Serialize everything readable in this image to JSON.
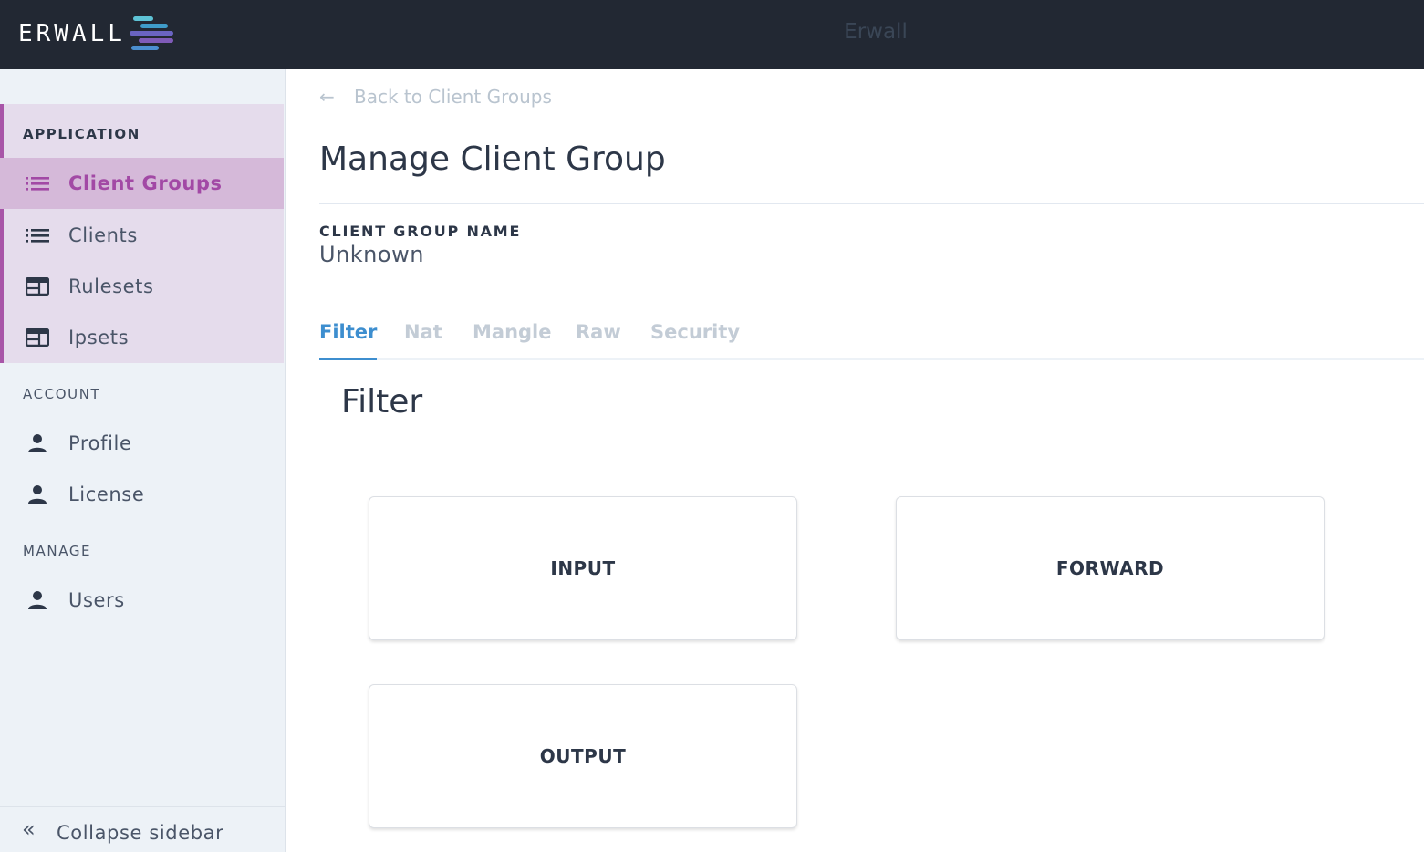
{
  "header": {
    "logo_text": "ERWALL",
    "title": "Erwall"
  },
  "sidebar": {
    "sections": [
      {
        "label": "APPLICATION"
      },
      {
        "label": "ACCOUNT"
      },
      {
        "label": "MANAGE"
      }
    ],
    "items": [
      {
        "label": "Client Groups",
        "icon": "list-icon",
        "active": true
      },
      {
        "label": "Clients",
        "icon": "list-icon"
      },
      {
        "label": "Rulesets",
        "icon": "table-icon"
      },
      {
        "label": "Ipsets",
        "icon": "table-icon"
      },
      {
        "label": "Profile",
        "icon": "user-icon"
      },
      {
        "label": "License",
        "icon": "user-icon"
      },
      {
        "label": "Users",
        "icon": "user-icon"
      }
    ],
    "collapse_label": "Collapse sidebar"
  },
  "main": {
    "back_link": "Back to Client Groups",
    "page_title": "Manage Client Group",
    "field_label": "CLIENT GROUP NAME",
    "field_value": "Unknown",
    "tabs": [
      {
        "label": "Filter",
        "active": true
      },
      {
        "label": "Nat"
      },
      {
        "label": "Mangle"
      },
      {
        "label": "Raw"
      },
      {
        "label": "Security"
      }
    ],
    "section_title": "Filter",
    "chains": [
      "INPUT",
      "FORWARD",
      "OUTPUT"
    ]
  },
  "colors": {
    "header_bg": "#222833",
    "sidebar_bg": "#edf2f7",
    "accent_purple": "#a249a5",
    "active_tab_blue": "#3d8ecf"
  }
}
